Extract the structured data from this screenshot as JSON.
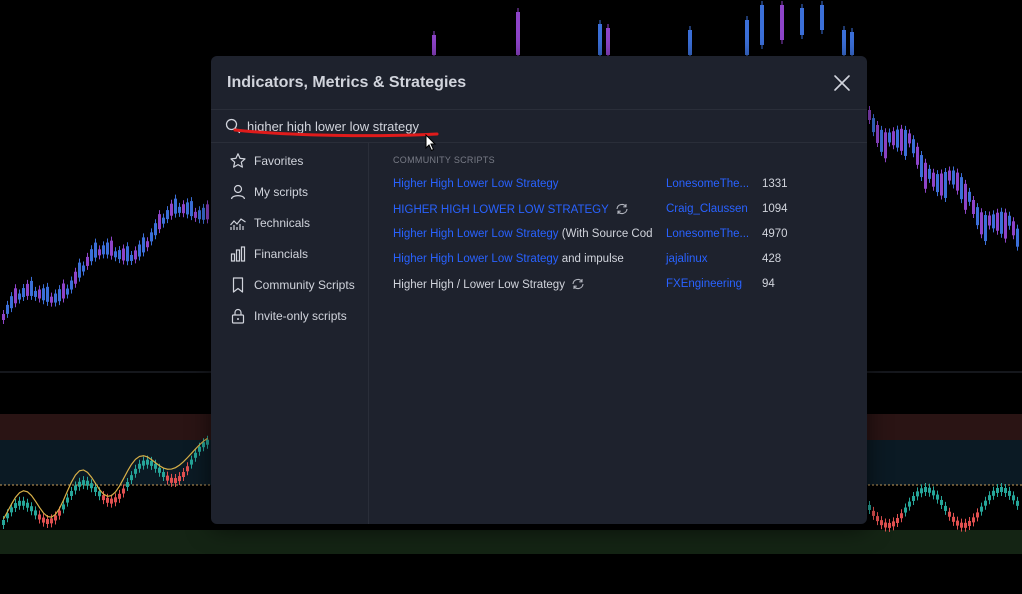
{
  "dialog": {
    "title": "Indicators, Metrics & Strategies"
  },
  "search": {
    "value": "higher high lower low strategy"
  },
  "sidebar": {
    "items": [
      {
        "label": "Favorites",
        "icon": "star-icon"
      },
      {
        "label": "My scripts",
        "icon": "user-icon"
      },
      {
        "label": "Technicals",
        "icon": "technicals-icon"
      },
      {
        "label": "Financials",
        "icon": "bar-chart-icon"
      },
      {
        "label": "Community Scripts",
        "icon": "bookmark-icon"
      },
      {
        "label": "Invite-only scripts",
        "icon": "lock-icon"
      }
    ]
  },
  "results": {
    "section_title": "COMMUNITY SCRIPTS",
    "rows": [
      {
        "name_highlight": "Higher High Lower Low Strategy",
        "name_rest": "",
        "author": "LonesomeThe...",
        "likes": "1331",
        "updated": false
      },
      {
        "name_highlight": "HIGHER HIGH LOWER LOW STRATEGY",
        "name_rest": "",
        "author": "Craig_Claussen",
        "likes": "1094",
        "updated": true
      },
      {
        "name_highlight": "Higher High Lower Low Strategy",
        "name_rest": " (With Source Cod...",
        "author": "LonesomeThe...",
        "likes": "4970",
        "updated": false
      },
      {
        "name_highlight": "Higher High Lower Low Strategy",
        "name_rest": " and impulse",
        "author": "jajalinux",
        "likes": "428",
        "updated": false
      },
      {
        "name_highlight": "Higher High / Lower Low Strategy",
        "name_rest": "",
        "author": "FXEngineering",
        "likes": "94",
        "updated": true,
        "plain": true
      }
    ]
  },
  "colors": {
    "dialog_bg": "#1e222d",
    "accent_blue": "#2962ff",
    "text": "#d1d4dc",
    "muted": "#787b86",
    "annotation_red": "#e01b1b",
    "candle_up": "#3b6fd8",
    "candle_down": "#8e44c9"
  }
}
